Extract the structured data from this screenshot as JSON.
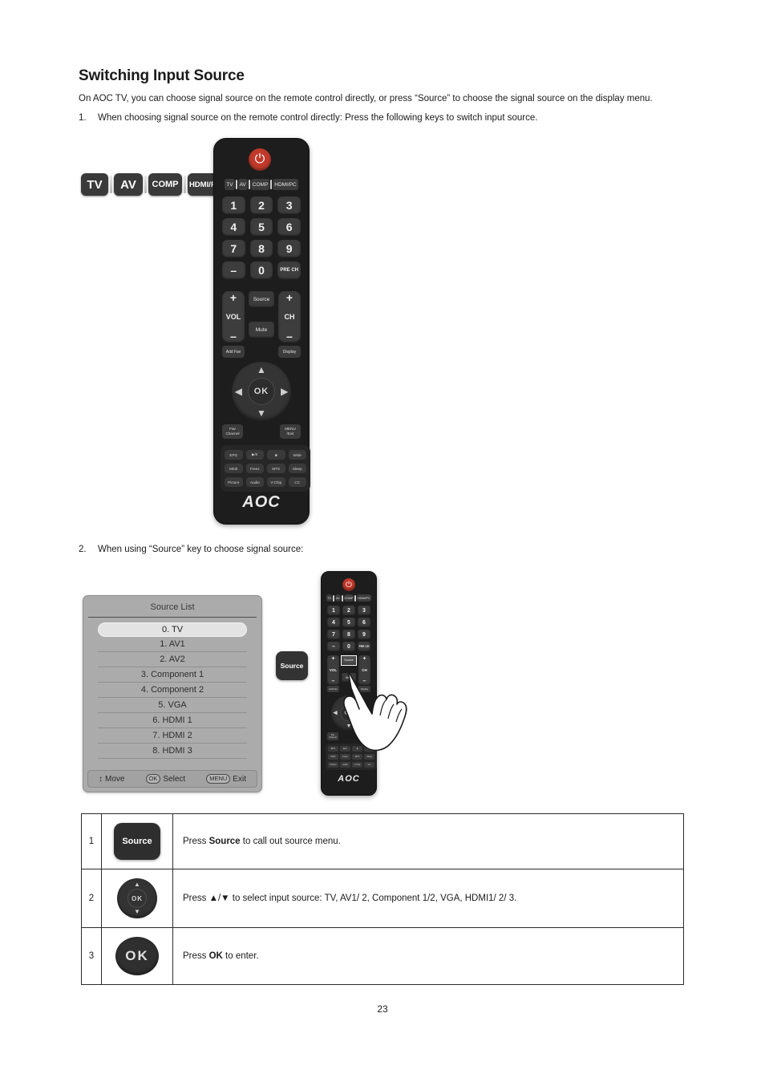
{
  "document": {
    "title": "Switching Input Source",
    "intro": "On AOC TV, you can choose signal source on the remote control directly, or press “Source” to choose the signal source on the display menu.",
    "page_number": "23"
  },
  "steps_text": {
    "one_num": "1.",
    "one": "When choosing signal source on the remote control directly: Press the following keys to switch input source.",
    "two_num": "2.",
    "two": "When using “Source” key to choose signal source:"
  },
  "key_group": {
    "keys": [
      {
        "label": "TV"
      },
      {
        "label": "AV"
      },
      {
        "label": "COMP"
      },
      {
        "label": "HDMI/PC"
      }
    ]
  },
  "remote": {
    "brand": "AOC",
    "power_icon": "power-icon",
    "source_row": [
      "TV",
      "AV",
      "COMP",
      "HDMI/PC"
    ],
    "keypad": [
      "1",
      "2",
      "3",
      "4",
      "5",
      "6",
      "7",
      "8",
      "9",
      "–",
      "0",
      "PRE CH"
    ],
    "vol": {
      "plus": "+",
      "label": "VOL",
      "minus": "–"
    },
    "ch": {
      "plus": "+",
      "label": "CH",
      "minus": "–"
    },
    "source_button": "Source",
    "mute_button": "Mute",
    "add_fav": "Add Fav",
    "display": "Display",
    "ok": "OK",
    "fav_channel_l1": "Fav",
    "fav_channel_l2": "Channel",
    "menu_exit_l1": "MENU",
    "menu_exit_l2": "/Exit",
    "functions": [
      "EPG",
      "▶/II",
      "■",
      "Wide",
      "Mtob",
      "Freez",
      "MTS",
      "Sleep",
      "Picture",
      "Audio",
      "V-Chip",
      "CC"
    ]
  },
  "callout": {
    "source_label": "Source"
  },
  "osd": {
    "title": "Source List",
    "items": [
      {
        "label": "0. TV",
        "selected": true
      },
      {
        "label": "1. AV1",
        "selected": false
      },
      {
        "label": "2. AV2",
        "selected": false
      },
      {
        "label": "3. Component 1",
        "selected": false
      },
      {
        "label": "4. Component 2",
        "selected": false
      },
      {
        "label": "5. VGA",
        "selected": false
      },
      {
        "label": "6. HDMI 1",
        "selected": false
      },
      {
        "label": "7. HDMI 2",
        "selected": false
      },
      {
        "label": "8. HDMI 3",
        "selected": false
      }
    ],
    "footer": {
      "move_cap": "↕",
      "move_label": "Move",
      "select_cap": "OK",
      "select_label": "Select",
      "exit_cap": "MENU",
      "exit_label": "Exit"
    }
  },
  "table": {
    "rows": [
      {
        "num": "1",
        "icon": "source-button-icon",
        "icon_label": "Source",
        "desc_pre": "Press ",
        "desc_bold": "Source",
        "desc_post": " to call out source menu."
      },
      {
        "num": "2",
        "icon": "updown-nav-icon",
        "icon_label": "OK",
        "desc_pre": "Press ▲/▼ to select input source: TV, AV1/ 2, Component 1/2, VGA, HDMI1/ 2/ 3.",
        "desc_bold": "",
        "desc_post": ""
      },
      {
        "num": "3",
        "icon": "ok-button-icon",
        "icon_label": "OK",
        "desc_pre": "Press ",
        "desc_bold": "OK",
        "desc_post": " to enter."
      }
    ]
  }
}
